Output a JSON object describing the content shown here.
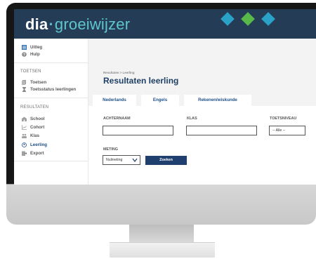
{
  "app": {
    "logo_prefix": "dia",
    "logo_dot": "·",
    "logo_suffix": "groeiwijzer",
    "brand_colors": {
      "header": "#243c55",
      "accent_teal": "#2aa1c7",
      "accent_green": "#59b84a"
    }
  },
  "sidebar": {
    "top_items": [
      {
        "label": "Uitleg",
        "icon": "list-icon"
      },
      {
        "label": "Hulp",
        "icon": "help-icon"
      }
    ],
    "section_tests": "TOETSEN",
    "test_items": [
      {
        "label": "Toetsen",
        "icon": "documents-icon"
      },
      {
        "label": "Toetsstatus leerlingen",
        "icon": "hourglass-icon"
      }
    ],
    "section_results": "RESULTATEN",
    "result_items": [
      {
        "label": "School",
        "icon": "school-icon"
      },
      {
        "label": "Cohort",
        "icon": "chart-icon"
      },
      {
        "label": "Klas",
        "icon": "group-icon"
      },
      {
        "label": "Leerling",
        "icon": "user-icon",
        "active": true
      },
      {
        "label": "Export",
        "icon": "export-icon"
      }
    ]
  },
  "main": {
    "breadcrumb": "Resultaten > Leerling",
    "title": "Resultaten leerling",
    "tabs": [
      {
        "label": "Nederlands",
        "active": true
      },
      {
        "label": "Engels"
      },
      {
        "label": "Rekenen/wiskunde"
      }
    ],
    "form": {
      "achternaam_label": "ACHTERNAAM",
      "achternaam_value": "",
      "klas_label": "KLAS",
      "klas_value": "",
      "toetsniveau_label": "TOETSNIVEAU",
      "toetsniveau_value": "-- Alle --",
      "meting_label": "METING",
      "meting_value": "Nulmeting",
      "search_button": "Zoeken"
    }
  }
}
